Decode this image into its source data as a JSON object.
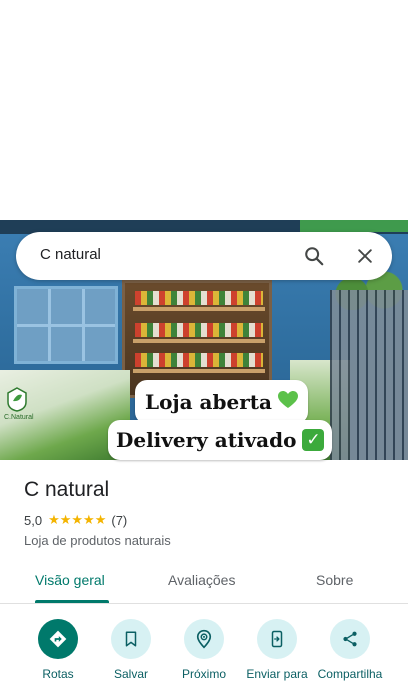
{
  "search": {
    "query": "C natural"
  },
  "hero": {
    "badge_1": "Loja aberta",
    "badge_2": "Delivery ativado",
    "logo_text": "C.Natural"
  },
  "place": {
    "name": "C natural",
    "rating": "5,0",
    "stars": "★★★★★",
    "rating_count": 7,
    "rating_count_display": "(7)",
    "category": "Loja de produtos naturais"
  },
  "tabs": [
    {
      "label": "Visão geral",
      "selected": true
    },
    {
      "label": "Avaliações",
      "selected": false
    },
    {
      "label": "Sobre",
      "selected": false
    }
  ],
  "actions": [
    {
      "label": "Rotas",
      "icon": "directions-icon"
    },
    {
      "label": "Salvar",
      "icon": "bookmark-icon"
    },
    {
      "label": "Próximo",
      "icon": "nearby-icon"
    },
    {
      "label": "Enviar para",
      "icon": "send-to-phone-icon"
    },
    {
      "label": "Compartilha",
      "icon": "share-icon"
    }
  ],
  "colors": {
    "accent": "#00796b",
    "action_bg": "#d7f1f3",
    "star": "#f4b400"
  }
}
